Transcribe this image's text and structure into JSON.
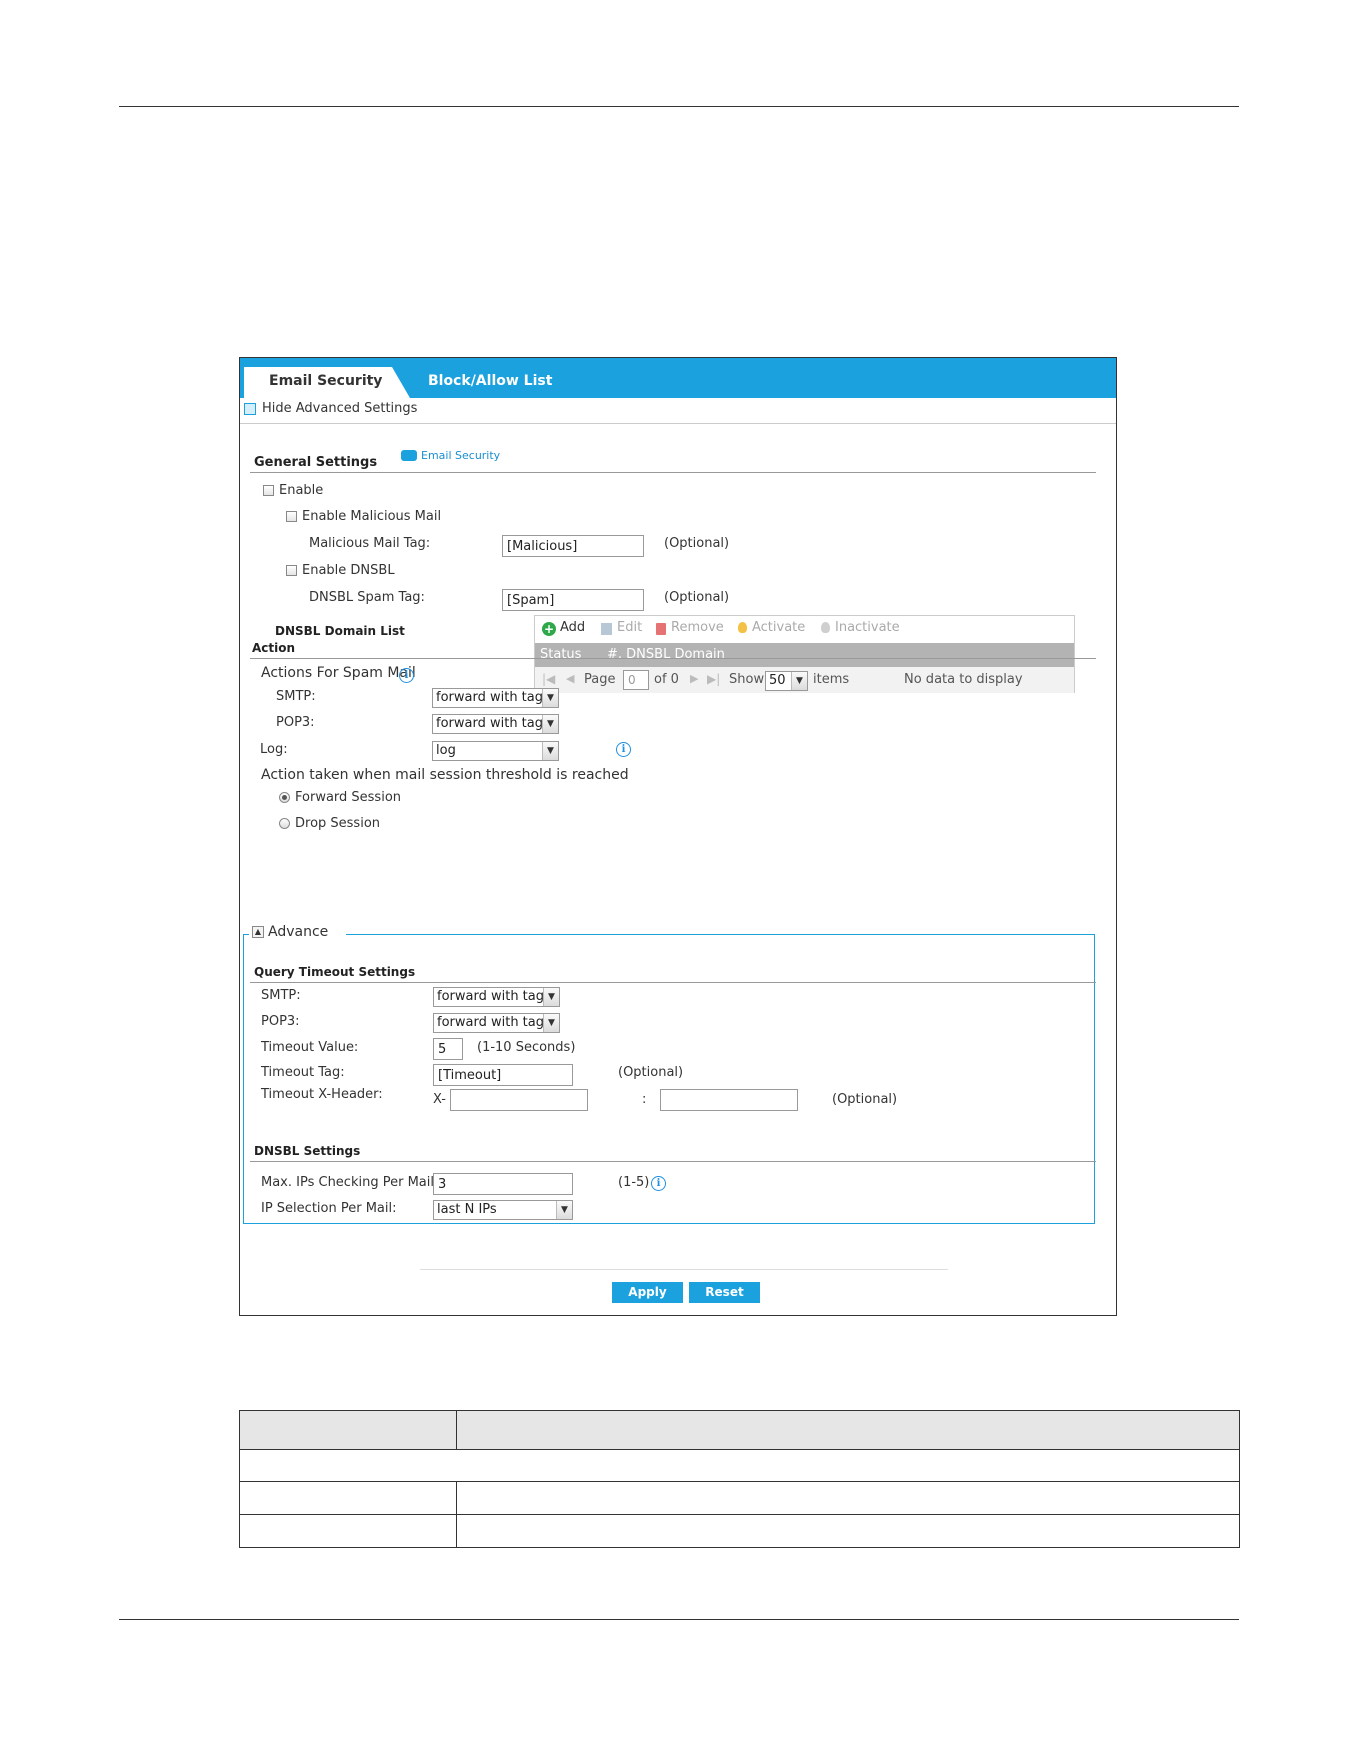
{
  "tabs": [
    {
      "label": "Email Security",
      "active": true
    },
    {
      "label": "Block/Allow List",
      "active": false
    }
  ],
  "hide_advanced_label": "Hide Advanced Settings",
  "general": {
    "heading": "General Settings",
    "help_link": "Email Security",
    "enable_label": "Enable",
    "malicious": {
      "enable_label": "Enable Malicious Mail",
      "tag_label": "Malicious Mail Tag:",
      "tag_value": "[Malicious]",
      "optional": "(Optional)"
    },
    "dnsbl": {
      "enable_label": "Enable DNSBL",
      "tag_label": "DNSBL Spam Tag:",
      "tag_value": "[Spam]",
      "optional": "(Optional)"
    },
    "domain_list_label": "DNSBL Domain List"
  },
  "grid": {
    "toolbar": {
      "add": "Add",
      "edit": "Edit",
      "remove": "Remove",
      "activate": "Activate",
      "inactivate": "Inactivate"
    },
    "columns": [
      "Status",
      "#. DNSBL Domain"
    ],
    "pager": {
      "page_label": "Page",
      "page_value": "0",
      "of_label": "of 0",
      "show_label": "Show",
      "show_value": "50",
      "items_label": "items",
      "empty": "No data to display"
    }
  },
  "action": {
    "heading": "Action",
    "spam_heading": "Actions For Spam Mail",
    "smtp_label": "SMTP:",
    "smtp_value": "forward with tag",
    "pop3_label": "POP3:",
    "pop3_value": "forward with tag",
    "log_label": "Log:",
    "log_value": "log",
    "threshold_heading": "Action taken when mail session threshold is reached",
    "forward_label": "Forward Session",
    "drop_label": "Drop Session",
    "selected": "Forward Session"
  },
  "advance": {
    "toggle_label": "Advance",
    "query": {
      "heading": "Query Timeout Settings",
      "smtp_label": "SMTP:",
      "smtp_value": "forward with tag",
      "pop3_label": "POP3:",
      "pop3_value": "forward with tag",
      "timeout_label": "Timeout Value:",
      "timeout_value": "5",
      "timeout_hint": "(1-10 Seconds)",
      "tag_label": "Timeout Tag:",
      "tag_value": "[Timeout]",
      "tag_optional": "(Optional)",
      "xheader_label": "Timeout X-Header:",
      "xheader_prefix": "X-",
      "xheader_sep": ":",
      "xheader_optional": "(Optional)"
    },
    "dnsbl": {
      "heading": "DNSBL Settings",
      "max_label": "Max. IPs Checking Per Mail:",
      "max_value": "3",
      "max_hint": "(1-5)",
      "ipsel_label": "IP Selection Per Mail:",
      "ipsel_value": "last N IPs"
    }
  },
  "buttons": {
    "apply": "Apply",
    "reset": "Reset"
  },
  "colors": {
    "accent": "#1aa1de",
    "header_gray": "#b3b3b3"
  }
}
